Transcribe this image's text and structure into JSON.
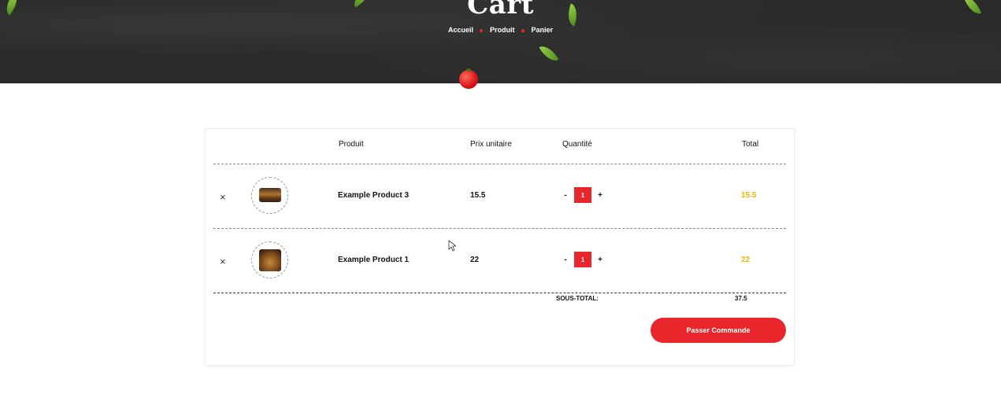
{
  "hero": {
    "title": "Cart",
    "breadcrumb": [
      "Accueil",
      "Produit",
      "Panier"
    ]
  },
  "table": {
    "headers": {
      "product": "Produit",
      "unit_price": "Prix unitaire",
      "quantity": "Quantité",
      "total": "Total"
    },
    "rows": [
      {
        "remove": "×",
        "name": "Example Product 3",
        "price": "15.5",
        "minus": "-",
        "qty": "1",
        "plus": "+",
        "total": "15.5"
      },
      {
        "remove": "×",
        "name": "Example Product 1",
        "price": "22",
        "minus": "-",
        "qty": "1",
        "plus": "+",
        "total": "22"
      }
    ]
  },
  "summary": {
    "subtotal_label": "SOUS-TOTAL:",
    "subtotal_value": "37.5"
  },
  "actions": {
    "order_label": "Passer Commande"
  },
  "colors": {
    "accent": "#e8262b",
    "total": "#f5b400",
    "hero_bg": "#2a2a2a"
  }
}
